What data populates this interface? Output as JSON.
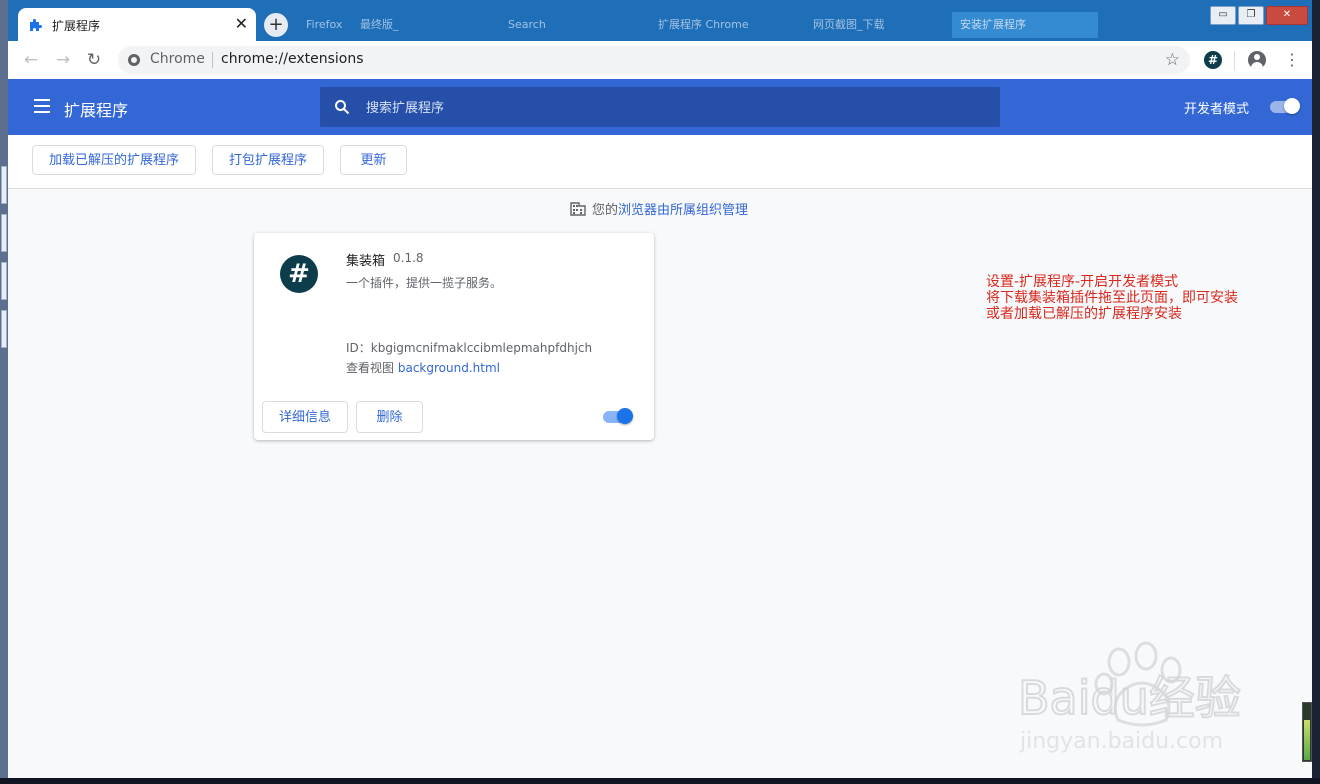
{
  "browser": {
    "active_tab_title": "扩展程序",
    "close_glyph": "✕",
    "new_tab_glyph": "+",
    "background_tabs": [
      "Firefox",
      "最终版_",
      "Search",
      "扩展程序 Chrome",
      "网页截图_下载",
      "安装扩展程序"
    ],
    "window_controls": {
      "minimize": "▭",
      "restore": "❐",
      "close": "✕"
    },
    "nav": {
      "back": "←",
      "forward": "→",
      "reload": "↻"
    },
    "omnibox": {
      "chip": "Chrome",
      "url": "chrome://extensions",
      "bookmark_glyph": "☆"
    },
    "extension_button_glyph": "#",
    "menu_glyph": "⋮"
  },
  "header": {
    "title": "扩展程序",
    "search_placeholder": "搜索扩展程序",
    "dev_mode_label": "开发者模式",
    "dev_mode_on": true
  },
  "subbar": {
    "load_unpacked": "加载已解压的扩展程序",
    "pack": "打包扩展程序",
    "update": "更新"
  },
  "managed": {
    "prefix": "您的",
    "link": "浏览器由所属组织管理"
  },
  "extension": {
    "logo_glyph": "#",
    "name": "集装箱",
    "version": "0.1.8",
    "description": "一个插件，提供一揽子服务。",
    "id_text": "ID：kbgigmcnifmaklccibmlepmahpfdhjch",
    "views_label": "查看视图",
    "views_link": "background.html",
    "details_button": "详细信息",
    "remove_button": "删除",
    "enabled": true
  },
  "annotation": [
    "设置-扩展程序-开启开发者模式",
    "将下载集装箱插件拖至此页面，即可安装",
    "或者加载已解压的扩展程序安装"
  ],
  "watermark": {
    "brand_text": "Baidu经验",
    "url_text": "jingyan.baidu.com"
  },
  "colors": {
    "header_blue": "#3367d6",
    "link_blue": "#3367d6",
    "annotation_red": "#d9281e",
    "logo_dark": "#0d3c4a"
  }
}
